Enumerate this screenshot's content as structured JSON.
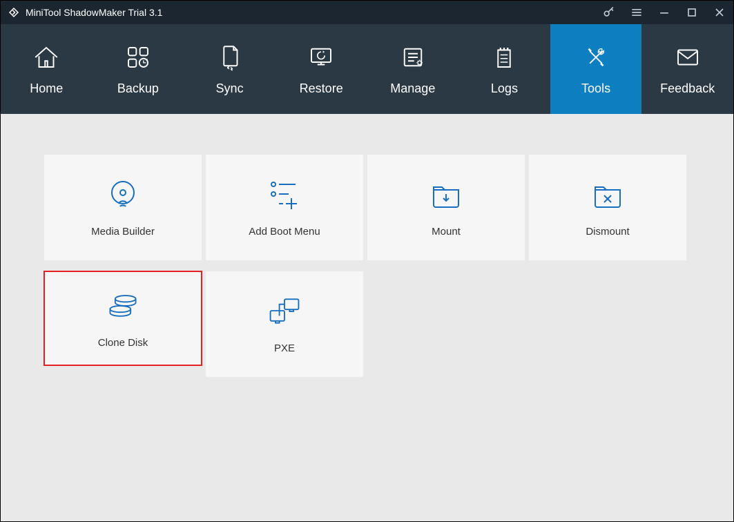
{
  "title": "MiniTool ShadowMaker Trial 3.1",
  "nav": [
    {
      "label": "Home"
    },
    {
      "label": "Backup"
    },
    {
      "label": "Sync"
    },
    {
      "label": "Restore"
    },
    {
      "label": "Manage"
    },
    {
      "label": "Logs"
    },
    {
      "label": "Tools"
    },
    {
      "label": "Feedback"
    }
  ],
  "active_nav": "Tools",
  "tiles": [
    {
      "label": "Media Builder"
    },
    {
      "label": "Add Boot Menu"
    },
    {
      "label": "Mount"
    },
    {
      "label": "Dismount"
    },
    {
      "label": "Clone Disk"
    },
    {
      "label": "PXE"
    }
  ],
  "highlight_tile": "Clone Disk"
}
